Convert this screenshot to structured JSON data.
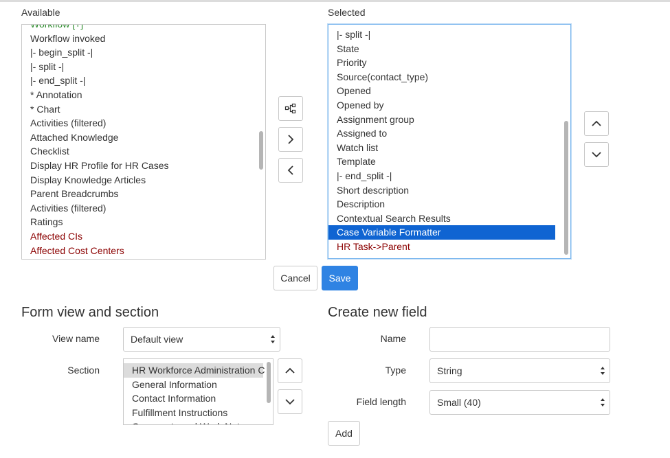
{
  "available": {
    "label": "Available",
    "items": [
      {
        "text": "Workflow [+]",
        "style": "green"
      },
      {
        "text": "Workflow invoked",
        "style": ""
      },
      {
        "text": "|- begin_split -|",
        "style": ""
      },
      {
        "text": "|- split -|",
        "style": ""
      },
      {
        "text": "|- end_split -|",
        "style": ""
      },
      {
        "text": "* Annotation",
        "style": ""
      },
      {
        "text": "* Chart",
        "style": ""
      },
      {
        "text": "Activities (filtered)",
        "style": ""
      },
      {
        "text": "Attached Knowledge",
        "style": ""
      },
      {
        "text": "Checklist",
        "style": ""
      },
      {
        "text": "Display HR Profile for HR Cases",
        "style": ""
      },
      {
        "text": "Display Knowledge Articles",
        "style": ""
      },
      {
        "text": "Parent Breadcrumbs",
        "style": ""
      },
      {
        "text": "Activities (filtered)",
        "style": ""
      },
      {
        "text": "Ratings",
        "style": ""
      },
      {
        "text": "Affected CIs",
        "style": "red"
      },
      {
        "text": "Affected Cost Centers",
        "style": "red"
      }
    ]
  },
  "selected": {
    "label": "Selected",
    "items": [
      {
        "text": "|- split -|",
        "style": ""
      },
      {
        "text": "State",
        "style": ""
      },
      {
        "text": "Priority",
        "style": ""
      },
      {
        "text": "Source(contact_type)",
        "style": ""
      },
      {
        "text": "Opened",
        "style": ""
      },
      {
        "text": "Opened by",
        "style": ""
      },
      {
        "text": "Assignment group",
        "style": ""
      },
      {
        "text": "Assigned to",
        "style": ""
      },
      {
        "text": "Watch list",
        "style": ""
      },
      {
        "text": "Template",
        "style": ""
      },
      {
        "text": "|- end_split -|",
        "style": ""
      },
      {
        "text": "Short description",
        "style": ""
      },
      {
        "text": "Description",
        "style": ""
      },
      {
        "text": "Contextual Search Results",
        "style": ""
      },
      {
        "text": "Case Variable Formatter",
        "style": "sel"
      },
      {
        "text": "HR Task->Parent",
        "style": "red"
      }
    ]
  },
  "buttons": {
    "cancel": "Cancel",
    "save": "Save",
    "add": "Add"
  },
  "icons": {
    "formatter": "formatter-tree-icon",
    "add": "chevron-right-icon",
    "remove": "chevron-left-icon",
    "up": "chevron-up-icon",
    "down": "chevron-down-icon"
  },
  "form_view": {
    "heading": "Form view and section",
    "view_name_label": "View name",
    "view_name_value": "Default view",
    "section_label": "Section",
    "sections": [
      {
        "text": "HR Workforce Administration C",
        "style": "graysel"
      },
      {
        "text": "General Information",
        "style": ""
      },
      {
        "text": "Contact Information",
        "style": ""
      },
      {
        "text": "Fulfillment Instructions",
        "style": ""
      },
      {
        "text": "Comments and Work Notes",
        "style": ""
      }
    ]
  },
  "create_field": {
    "heading": "Create new field",
    "name_label": "Name",
    "name_value": "",
    "type_label": "Type",
    "type_value": "String",
    "length_label": "Field length",
    "length_value": "Small (40)"
  },
  "colors": {
    "accent": "#2f83e3",
    "selection": "#0f64d2",
    "red_text": "#8b0000",
    "green_text": "#2a8a2a"
  }
}
